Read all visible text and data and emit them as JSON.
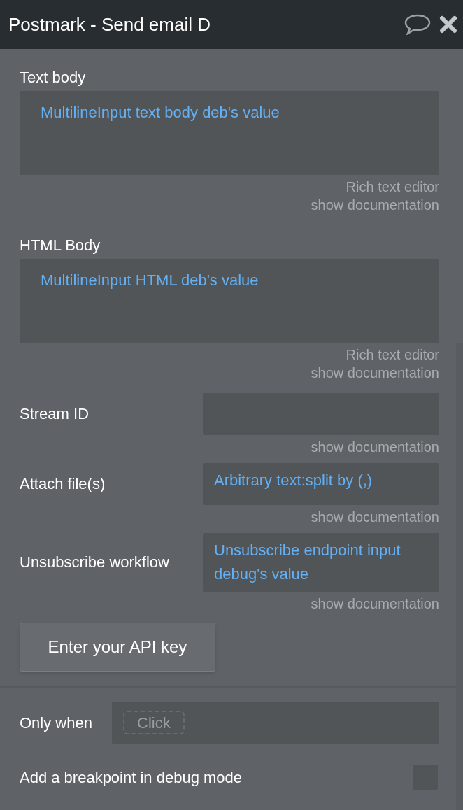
{
  "window": {
    "title": "Postmark - Send email D"
  },
  "fields": [
    {
      "kind": "multiline",
      "label": "Text body",
      "value": "MultilineInput text body deb's value",
      "links": [
        "Rich text editor",
        "show documentation"
      ]
    },
    {
      "kind": "multiline",
      "label": "HTML Body",
      "value": "MultilineInput HTML deb's value",
      "links": [
        "Rich text editor",
        "show documentation"
      ]
    },
    {
      "kind": "row",
      "label": "Stream ID",
      "links": [
        "show documentation"
      ]
    },
    {
      "kind": "row",
      "label": "Attach file(s)",
      "value": "Arbitrary text:split by (,)",
      "links": [
        "show documentation"
      ]
    },
    {
      "kind": "row",
      "label": "Unsubscribe workflow",
      "value": "Unsubscribe endpoint input debug's value",
      "links": [
        "show documentation"
      ]
    }
  ],
  "api_button": "Enter your API key",
  "only_when": {
    "label": "Only when",
    "placeholder": "Click"
  },
  "breakpoint": {
    "label": "Add a breakpoint in debug mode",
    "checked": false
  }
}
